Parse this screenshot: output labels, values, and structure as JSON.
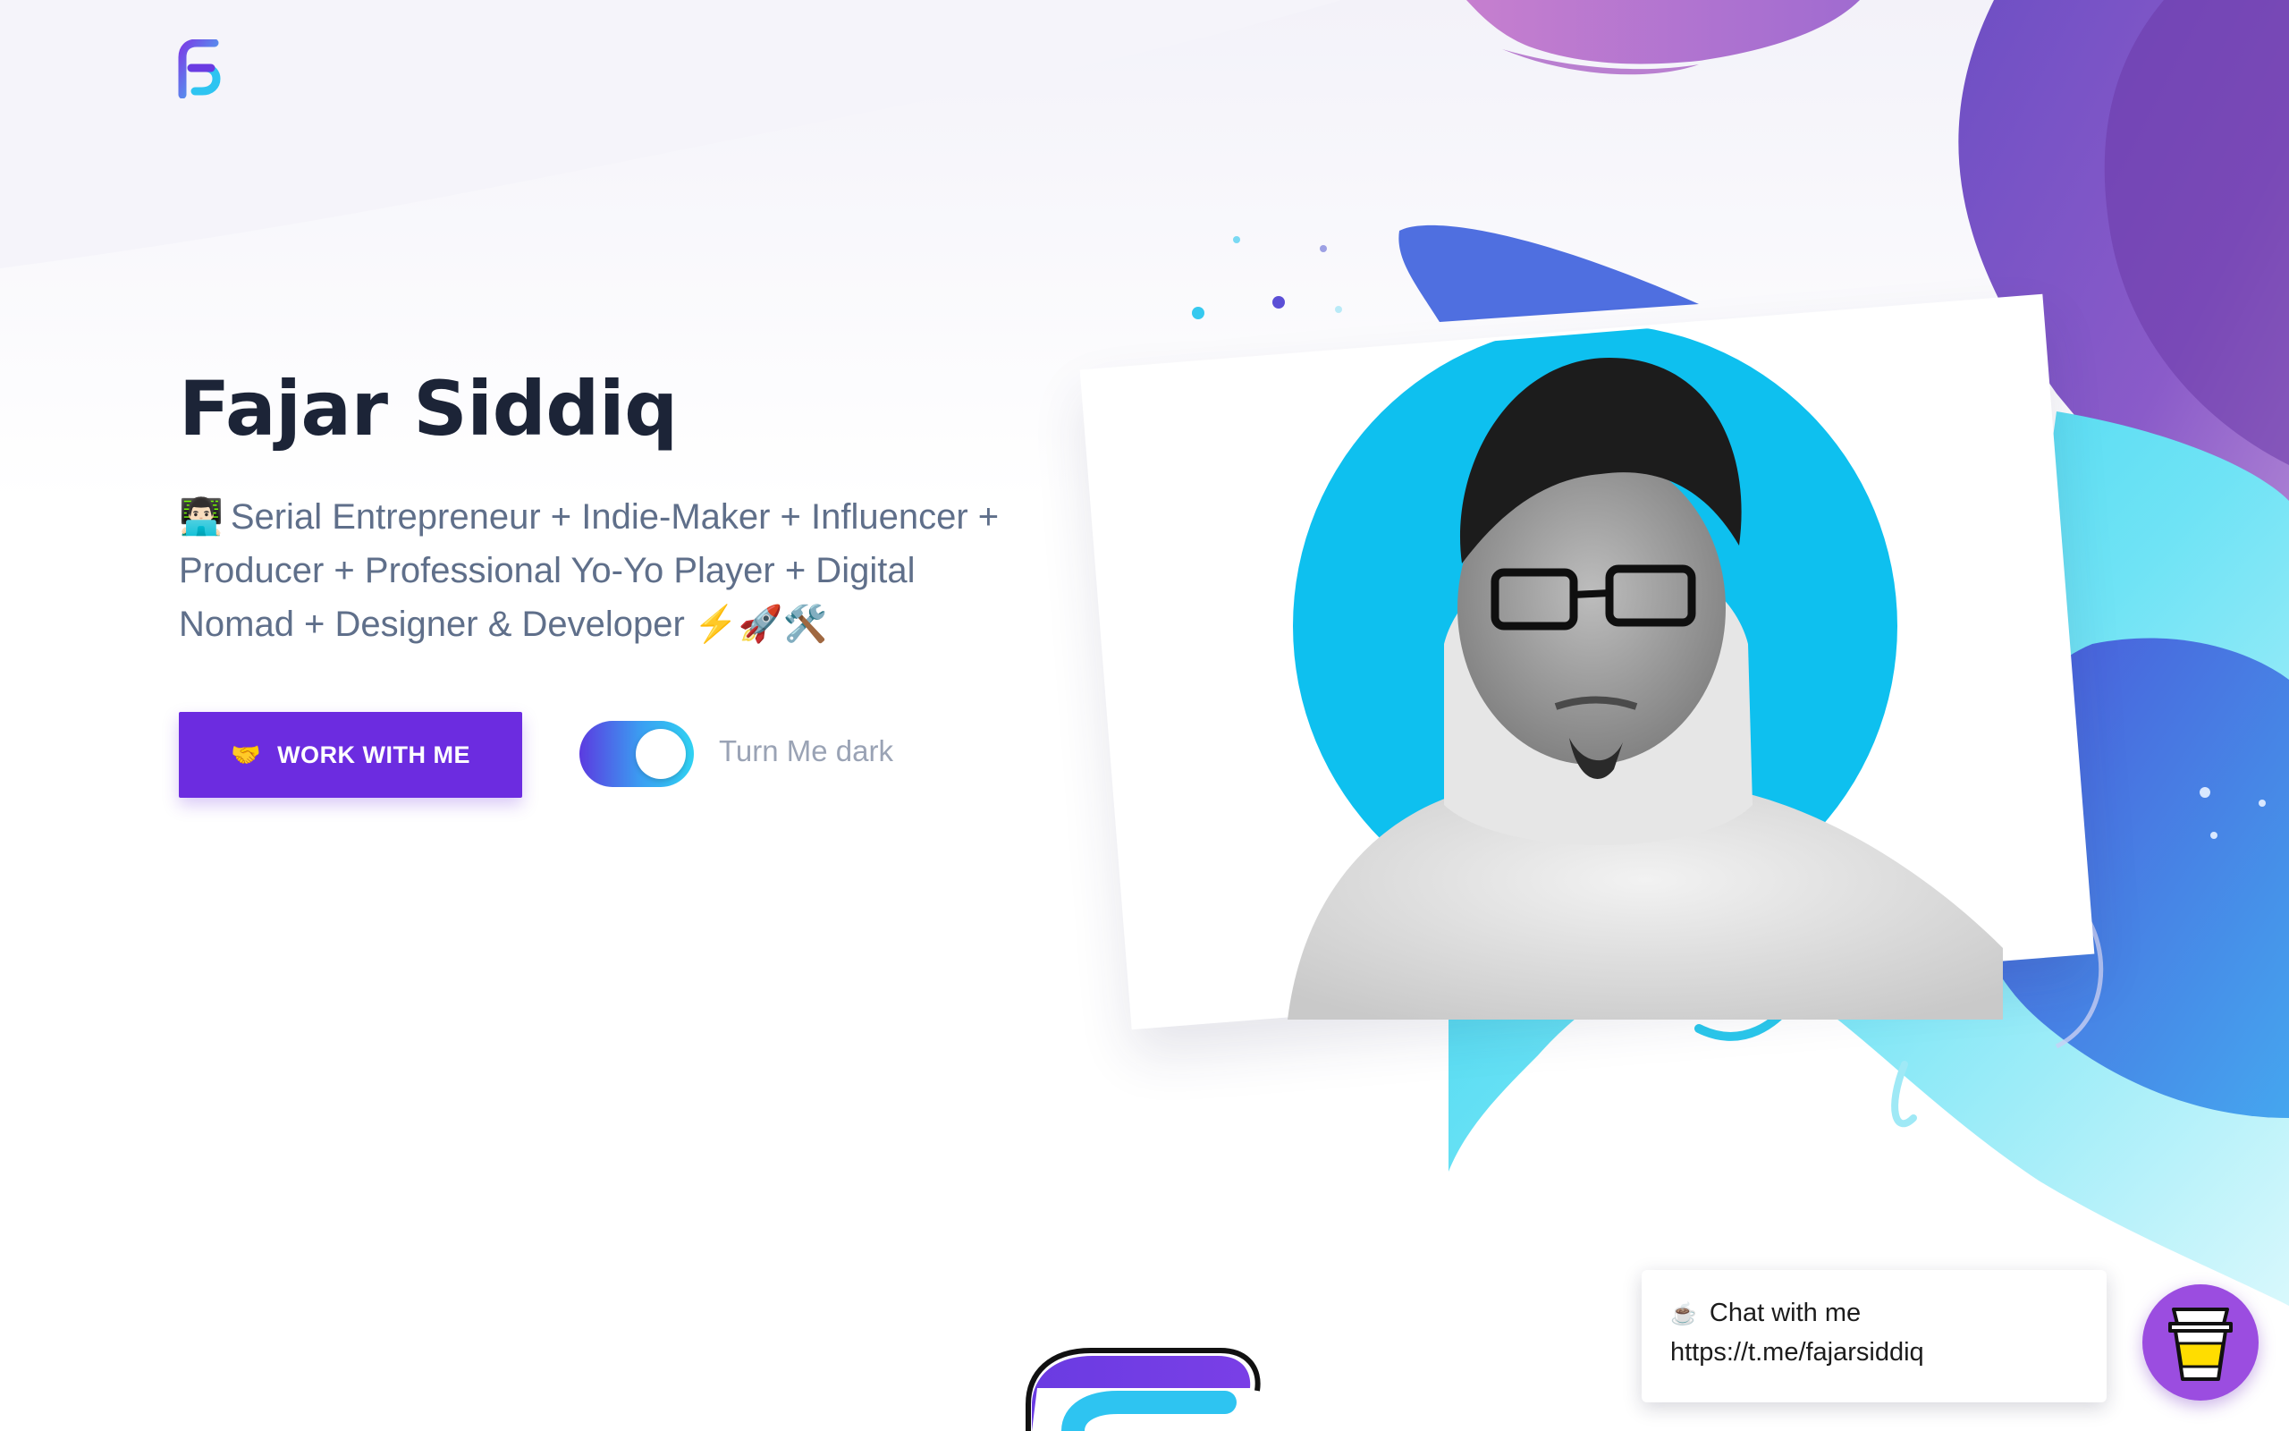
{
  "site": {
    "logo_icon": "fs-monogram-logo-icon",
    "bottom_logo_icon": "fs-monogram-logo-icon"
  },
  "hero": {
    "name": "Fajar Siddiq",
    "bio_emoji": "👨🏻‍💻",
    "bio_text": "Serial Entrepreneur + Indie-Maker + Influencer + Producer + Professional Yo-Yo Player + Digital Nomad + Designer & Developer",
    "bio_trailing_emojis": "⚡🚀🛠️",
    "cta": {
      "icon": "🤝",
      "label": "WORK WITH ME"
    },
    "dark_toggle": {
      "label": "Turn Me dark",
      "state": "on"
    },
    "profile_image": "portrait-photo"
  },
  "chat_widget": {
    "icon": "☕",
    "title": "Chat with me",
    "link": "https://t.me/fajarsiddiq"
  },
  "coffee_button": {
    "icon": "coffee-cup-icon"
  },
  "colors": {
    "brand_purple": "#6c2ce0",
    "accent_cyan": "#0ec0ef",
    "heading": "#1c2437",
    "body_text": "#5f6f8a",
    "muted_text": "#9aa3b5",
    "coffee_purple": "#9b4de0"
  }
}
